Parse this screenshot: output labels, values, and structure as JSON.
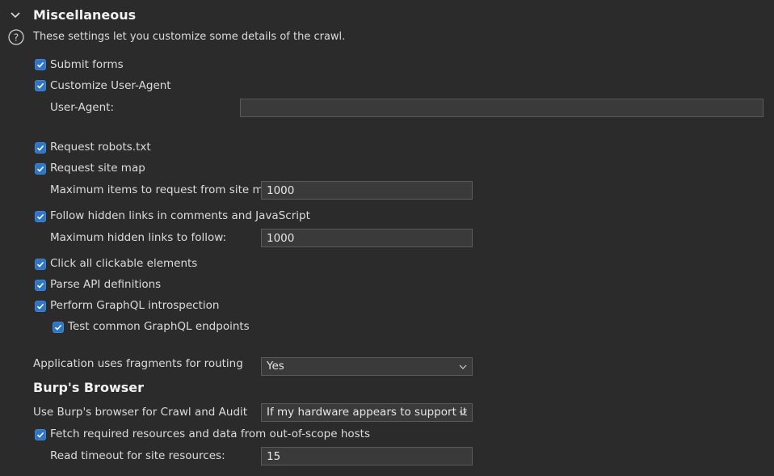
{
  "misc": {
    "title": "Miscellaneous",
    "description": "These settings let you customize some details of the crawl.",
    "submit_forms": {
      "label": "Submit forms",
      "checked": true
    },
    "customize_ua": {
      "label": "Customize User-Agent",
      "checked": true
    },
    "user_agent": {
      "label": "User-Agent:",
      "value": ""
    },
    "request_robots": {
      "label": "Request robots.txt",
      "checked": true
    },
    "request_sitemap": {
      "label": "Request site map",
      "checked": true
    },
    "max_sitemap": {
      "label": "Maximum items to request from site map:",
      "value": "1000"
    },
    "follow_hidden": {
      "label": "Follow hidden links in comments and JavaScript",
      "checked": true
    },
    "max_hidden": {
      "label": "Maximum hidden links to follow:",
      "value": "1000"
    },
    "click_clickable": {
      "label": "Click all clickable elements",
      "checked": true
    },
    "parse_api": {
      "label": "Parse API definitions",
      "checked": true
    },
    "graphql_intro": {
      "label": "Perform GraphQL introspection",
      "checked": true
    },
    "graphql_endpoints": {
      "label": "Test common GraphQL endpoints",
      "checked": true
    },
    "fragments": {
      "label": "Application uses fragments for routing",
      "value": "Yes"
    }
  },
  "browser": {
    "title": "Burp's Browser",
    "use_browser": {
      "label": "Use Burp's browser for Crawl and Audit",
      "value": "If my hardware appears to support it"
    },
    "fetch_resources": {
      "label": "Fetch required resources and data from out-of-scope hosts",
      "checked": true
    },
    "read_timeout": {
      "label": "Read timeout for site resources:",
      "value": "15"
    }
  },
  "colors": {
    "background": "#2b2b2b",
    "checkbox": "#2f75c4",
    "text": "#dcdcdc"
  }
}
